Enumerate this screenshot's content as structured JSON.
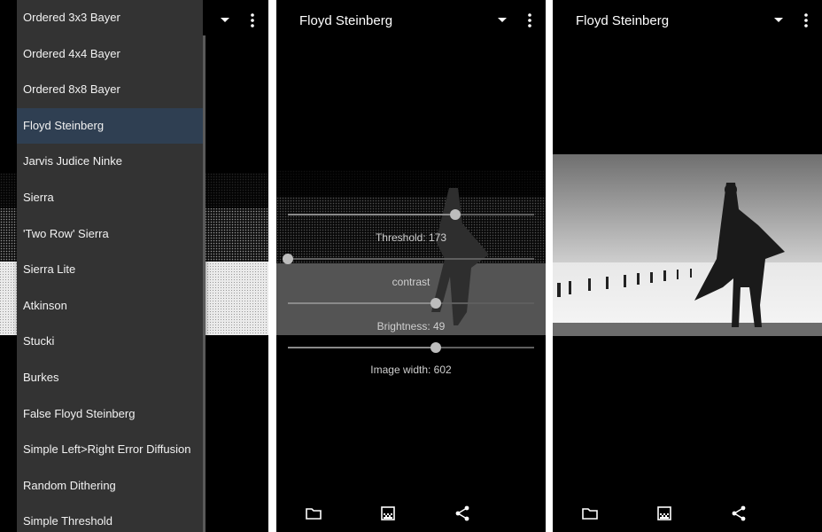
{
  "panel1": {
    "menu": {
      "items": [
        "Ordered 3x3 Bayer",
        "Ordered 4x4 Bayer",
        "Ordered 8x8 Bayer",
        "Floyd Steinberg",
        "Jarvis Judice Ninke",
        "Sierra",
        "'Two Row' Sierra",
        "Sierra Lite",
        "Atkinson",
        "Stucki",
        "Burkes",
        "False Floyd Steinberg",
        "Simple Left>Right Error Diffusion",
        "Random Dithering",
        "Simple Threshold"
      ],
      "selected_index": 3
    }
  },
  "panel2": {
    "title": "Floyd Steinberg",
    "sliders": {
      "threshold": {
        "label": "Threshold: 173",
        "fraction": 0.68
      },
      "contrast": {
        "label": "contrast",
        "fraction": 0.0
      },
      "brightness": {
        "label": "Brightness: 49",
        "fraction": 0.6
      },
      "width": {
        "label": "Image width: 602",
        "fraction": 0.6
      }
    }
  },
  "panel3": {
    "title": "Floyd Steinberg"
  },
  "icons": {
    "dropdown": "dropdown-arrow-icon",
    "more": "more-vert-icon",
    "folder": "folder-icon",
    "gradient": "gradient-icon",
    "share": "share-icon"
  }
}
